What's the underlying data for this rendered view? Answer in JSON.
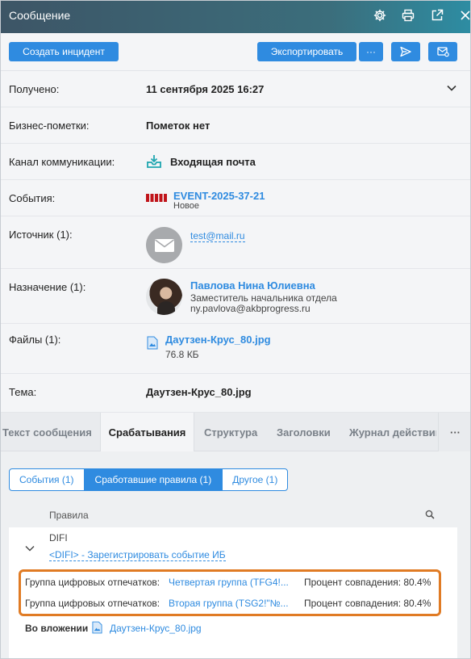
{
  "window": {
    "title": "Сообщение",
    "icons": [
      "gear-icon",
      "print-icon",
      "external-link-icon",
      "close-icon"
    ]
  },
  "toolbar": {
    "create_incident_label": "Создать инцидент",
    "export_label": "Экспортировать",
    "more_label": "···"
  },
  "fields": {
    "received": {
      "label": "Получено:",
      "value": "11 сентября 2025 16:27"
    },
    "business_notes": {
      "label": "Бизнес-пометки:",
      "value": "Пометок нет"
    },
    "channel": {
      "label": "Канал коммуникации:",
      "value": "Входящая почта"
    },
    "events": {
      "label": "События:",
      "event_id": "EVENT-2025-37-21",
      "event_status": "Новое"
    },
    "source": {
      "label": "Источник (1):",
      "email": "test@mail.ru"
    },
    "destination": {
      "label": "Назначение (1):",
      "name": "Павлова Нина Юлиевна",
      "position": "Заместитель начальника отдела",
      "email": "ny.pavlova@akbprogress.ru"
    },
    "files": {
      "label": "Файлы (1):",
      "file_name": "Даутзен-Крус_80.jpg",
      "file_size": "76.8 КБ"
    },
    "subject": {
      "label": "Тема:",
      "value": "Даутзен-Крус_80.jpg"
    }
  },
  "tabs": [
    {
      "label": "Текст сообщения"
    },
    {
      "label": "Срабатывания"
    },
    {
      "label": "Структура"
    },
    {
      "label": "Заголовки"
    },
    {
      "label": "Журнал действий"
    }
  ],
  "tabs_more": "···",
  "subtabs": [
    {
      "label": "События (1)"
    },
    {
      "label": "Сработавшие правила (1)"
    },
    {
      "label": "Другое (1)"
    }
  ],
  "rules": {
    "header": "Правила",
    "policy": "DIFI",
    "rule_link": "<DIFI> - Зарегистрировать событие ИБ",
    "fingerprints": [
      {
        "label": "Группа цифровых отпечатков:",
        "group": "Четвертая группа (TFG4!...",
        "match": "Процент совпадения: 80.4%"
      },
      {
        "label": "Группа цифровых отпечатков:",
        "group": "Вторая группа (TSG2!\"№...",
        "match": "Процент совпадения: 80.4%"
      }
    ],
    "attachment_label": "Во вложении",
    "attachment_file": "Даутзен-Крус_80.jpg"
  },
  "colors": {
    "accent": "#2f8be0",
    "highlight": "#e07b24",
    "event_red": "#c0141a"
  }
}
